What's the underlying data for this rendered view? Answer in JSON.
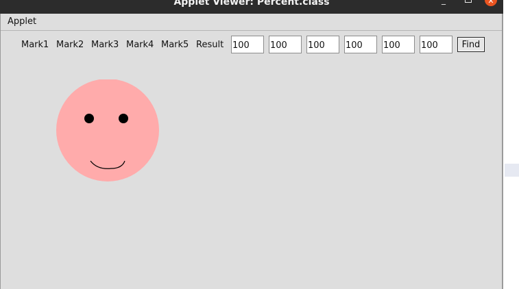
{
  "window": {
    "title": "Applet Viewer: Percent.class",
    "minimize_glyph": "_",
    "close_glyph": "✕"
  },
  "menu": {
    "applet_label": "Applet"
  },
  "labels": [
    "Mark1",
    "Mark2",
    "Mark3",
    "Mark4",
    "Mark5",
    "Result"
  ],
  "fields": [
    "100",
    "100",
    "100",
    "100",
    "100",
    "100"
  ],
  "find_label": "Find",
  "face": {
    "shape": "smiley",
    "fill_color": "#ffabab",
    "feature_color": "#000000"
  }
}
